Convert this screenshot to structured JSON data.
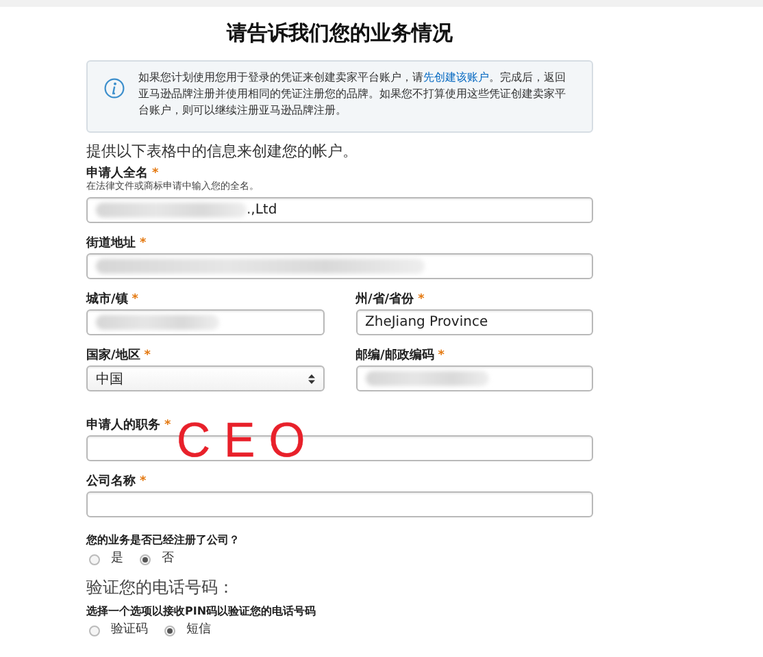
{
  "title": "请告诉我们您的业务情况",
  "notice": {
    "text_before": "如果您计划使用您用于登录的凭证来创建卖家平台账户，请",
    "link": "先创建该账户",
    "text_after": "。完成后，返回亚马逊品牌注册并使用相同的凭证注册您的品牌。如果您不打算使用这些凭证创建卖家平台账户，则可以继续注册亚马逊品牌注册。"
  },
  "intro": "提供以下表格中的信息来创建您的帐户。",
  "required_mark": "*",
  "rows": [
    {
      "fields": [
        {
          "label": "申请人全名",
          "required": true,
          "hint": "在法律文件或商标申请中输入您的全名。",
          "kind": "text",
          "value": ".,Ltd",
          "redacted": true
        }
      ]
    },
    {
      "fields": [
        {
          "label": "街道地址",
          "required": true,
          "kind": "text",
          "redacted": true
        }
      ]
    },
    {
      "fields": [
        {
          "label": "城市/镇",
          "required": true,
          "kind": "text",
          "redacted": true
        },
        {
          "label": "州/省/省份",
          "required": true,
          "kind": "text",
          "value": "ZheJiang Province"
        }
      ]
    },
    {
      "fields": [
        {
          "label": "国家/地区",
          "required": true,
          "kind": "select",
          "value": "中国"
        },
        {
          "label": "邮编/邮政编码",
          "required": true,
          "kind": "text",
          "redacted": true
        }
      ]
    },
    {
      "fields": [
        {
          "label": "申请人的职务",
          "required": true,
          "kind": "text",
          "annotation": "CEO"
        }
      ]
    },
    {
      "fields": [
        {
          "label": "公司名称",
          "required": true,
          "kind": "text"
        }
      ]
    }
  ],
  "company_question": {
    "question": "您的业务是否已经注册了公司？",
    "options": [
      {
        "label": "是",
        "selected": false
      },
      {
        "label": "否",
        "selected": true
      }
    ]
  },
  "phone_heading": "验证您的电话号码：",
  "phone_question": {
    "question": "选择一个选项以接收PIN码以验证您的电话号码",
    "options": [
      {
        "label": "验证码",
        "selected": false
      },
      {
        "label": "短信",
        "selected": true
      }
    ]
  }
}
